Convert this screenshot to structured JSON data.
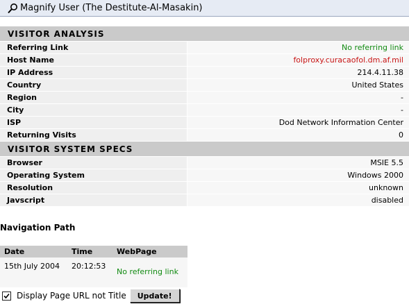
{
  "window": {
    "title": "Magnify User (The Destitute-Al-Masakin)"
  },
  "visitor_analysis": {
    "header": "VISITOR ANALYSIS",
    "rows": [
      {
        "label": "Referring Link",
        "value": "No referring link",
        "color": "#118a11"
      },
      {
        "label": "Host Name",
        "value": "folproxy.curacaofol.dm.af.mil",
        "color": "#c81414"
      },
      {
        "label": "IP Address",
        "value": "214.4.11.38"
      },
      {
        "label": "Country",
        "value": "United States"
      },
      {
        "label": "Region",
        "value": "-"
      },
      {
        "label": "City",
        "value": "-"
      },
      {
        "label": "ISP",
        "value": "Dod Network Information Center"
      },
      {
        "label": "Returning Visits",
        "value": "0"
      }
    ]
  },
  "visitor_system": {
    "header": "VISITOR SYSTEM SPECS",
    "rows": [
      {
        "label": "Browser",
        "value": "MSIE 5.5"
      },
      {
        "label": "Operating System",
        "value": "Windows 2000"
      },
      {
        "label": "Resolution",
        "value": "unknown"
      },
      {
        "label": "Javscript",
        "value": "disabled"
      }
    ]
  },
  "navigation": {
    "title": "Navigation Path",
    "columns": [
      "Date",
      "Time",
      "WebPage"
    ],
    "rows": [
      {
        "date": "15th July 2004",
        "time": "20:12:53",
        "page": "No referring link"
      }
    ]
  },
  "options": {
    "checkbox_label": "Display Page URL not Title",
    "checked": true,
    "update_label": "Update!"
  },
  "colors": {
    "green": "#118a11",
    "red": "#c81414",
    "header_bg": "#cacaca",
    "title_bar_bg": "#e6ebf4"
  },
  "icons": {
    "title": "magnifier-icon",
    "checkbox": "checkmark-icon"
  }
}
